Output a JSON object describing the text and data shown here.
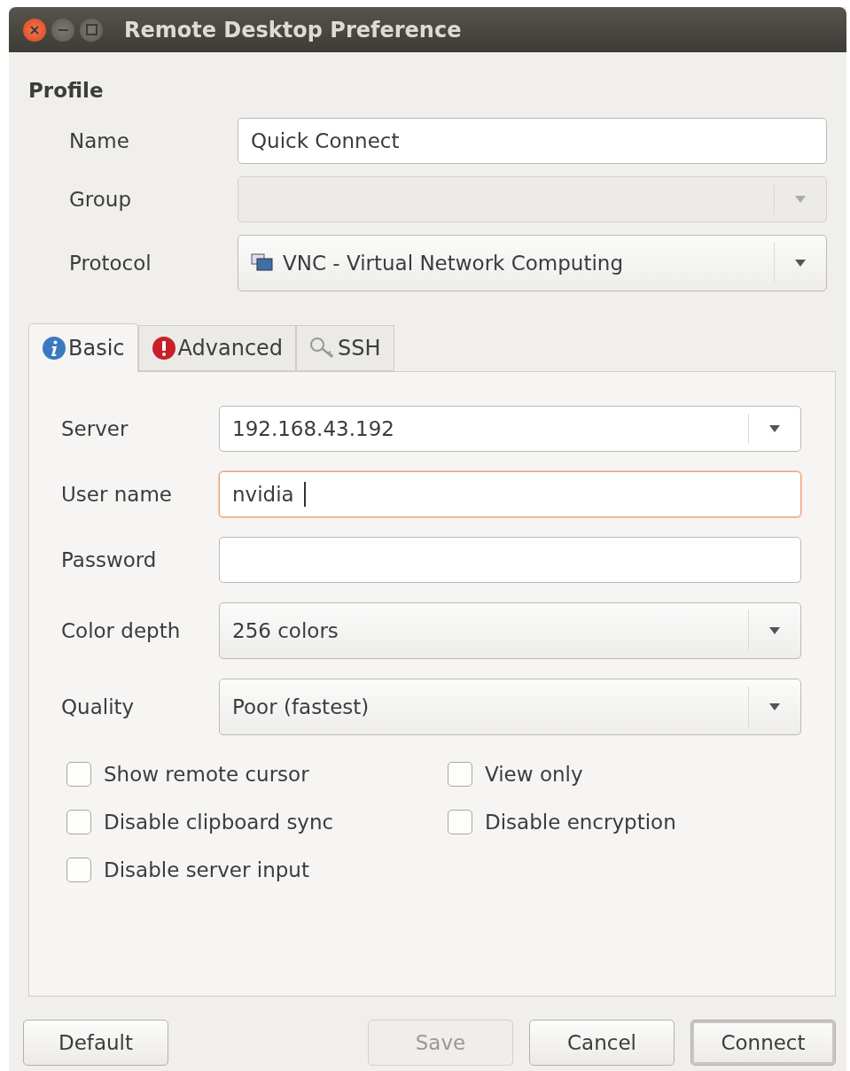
{
  "window": {
    "title": "Remote Desktop Preference"
  },
  "profile": {
    "heading": "Profile",
    "fields": [
      {
        "kind": "entry",
        "label": "Name",
        "value": "Quick Connect",
        "disabled": false
      },
      {
        "kind": "combo",
        "label": "Group",
        "disabled": true
      },
      {
        "kind": "protocol",
        "label": "Protocol",
        "value": "VNC - Virtual Network Computing",
        "disabled": false
      }
    ]
  },
  "tabs": [
    {
      "kind": "info",
      "label": "Basic",
      "selected": true
    },
    {
      "kind": "warning",
      "label": "Advanced",
      "selected": false
    },
    {
      "kind": "key",
      "label": "SSH",
      "selected": false
    }
  ],
  "basic": {
    "fields": [
      {
        "kind": "combo_entry",
        "label": "Server",
        "value": "192.168.43.192",
        "focused": false
      },
      {
        "kind": "entry",
        "label": "User name",
        "value": "nvidia",
        "focused": true
      },
      {
        "kind": "entry",
        "label": "Password",
        "focused": false
      },
      {
        "kind": "combo",
        "label": "Color depth",
        "value": "256 colors",
        "focused": false
      },
      {
        "kind": "combo",
        "label": "Quality",
        "value": "Poor (fastest)",
        "focused": false
      }
    ],
    "checkboxes": [
      {
        "label": "Show remote cursor",
        "checked": false
      },
      {
        "label": "View only",
        "checked": false
      },
      {
        "label": "Disable clipboard sync",
        "checked": false
      },
      {
        "label": "Disable encryption",
        "checked": false
      },
      {
        "label": "Disable server input",
        "checked": false
      }
    ]
  },
  "buttons": [
    {
      "label": "Default",
      "disabled": false,
      "default": false
    },
    {
      "label": "Save",
      "disabled": true,
      "default": false
    },
    {
      "label": "Cancel",
      "disabled": false,
      "default": false
    },
    {
      "label": "Connect",
      "disabled": false,
      "default": true
    }
  ]
}
